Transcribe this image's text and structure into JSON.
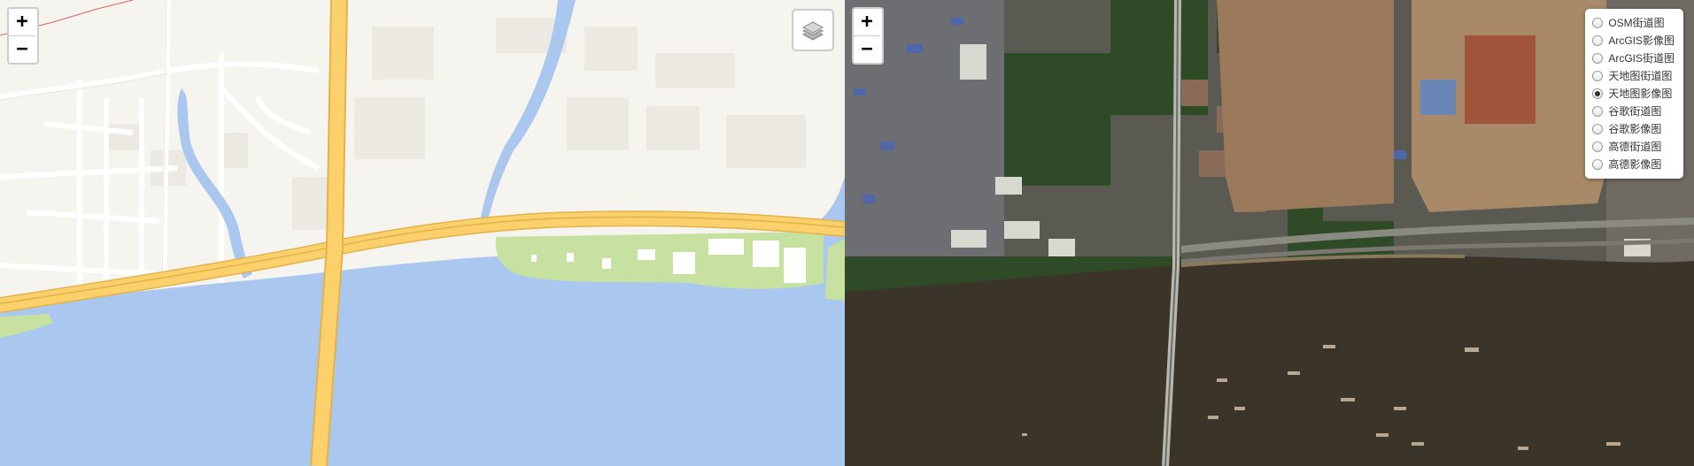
{
  "left_map": {
    "basemap": "street",
    "zoom_in_label": "+",
    "zoom_out_label": "−",
    "layers_toggle_icon": "layers-icon",
    "colors": {
      "land": "#f5f4ef",
      "water": "#aac7ef",
      "park": "#c6e1a0",
      "highway": "#fcd06a",
      "highway_edge": "#e3b24a",
      "road": "#ffffff",
      "road_edge": "#dedbd2",
      "building": "#ebe9e2"
    }
  },
  "right_map": {
    "basemap": "satellite",
    "zoom_in_label": "+",
    "zoom_out_label": "−",
    "colors": {
      "river": "#3b3428",
      "urban": "#5a5a52",
      "vegetation": "#2f4a26",
      "bare_soil": "#9a7a5a",
      "bridge": "#b8b8b0"
    }
  },
  "layers": {
    "selected_index": 4,
    "options": [
      {
        "label": "OSM街道图"
      },
      {
        "label": "ArcGIS影像图"
      },
      {
        "label": "ArcGIS街道图"
      },
      {
        "label": "天地图街道图"
      },
      {
        "label": "天地图影像图"
      },
      {
        "label": "谷歌街道图"
      },
      {
        "label": "谷歌影像图"
      },
      {
        "label": "高德街道图"
      },
      {
        "label": "高德影像图"
      }
    ]
  }
}
